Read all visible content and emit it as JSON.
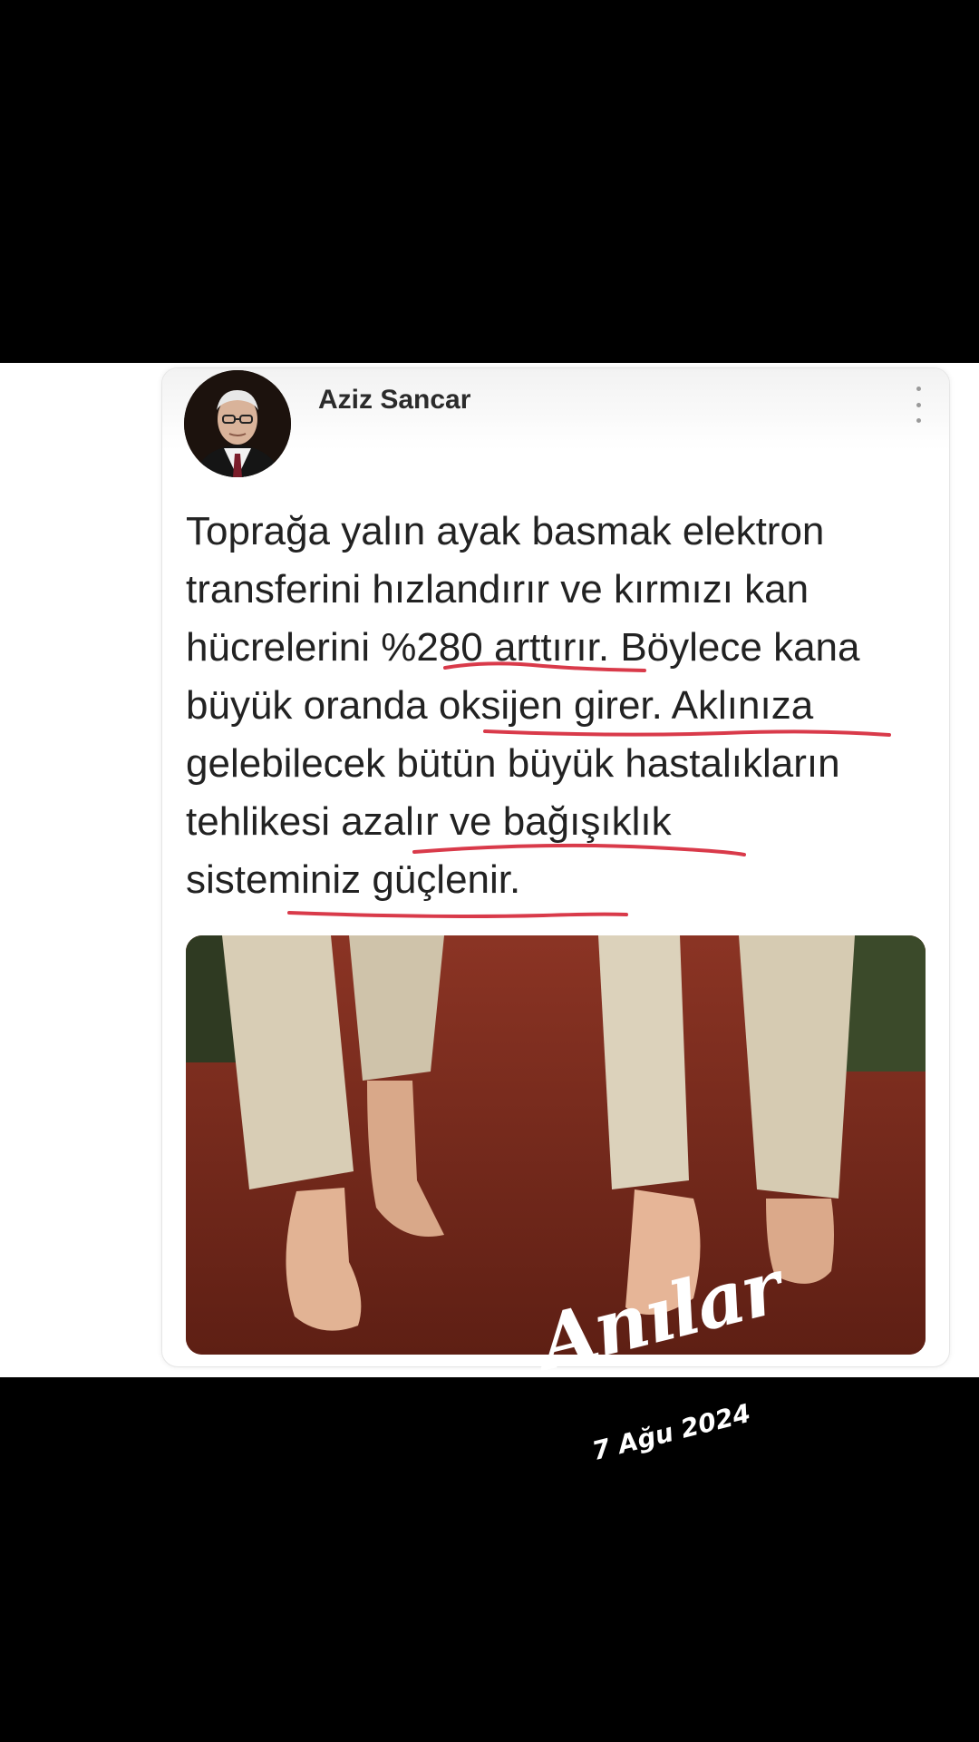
{
  "post": {
    "author": "Aziz Sancar",
    "text": "Toprağa yalın ayak basmak elektron\ntransferini hızlandırır ve kırmızı kan\nhücrelerini %280 arttırır. Böylece kana\nbüyük oranda oksijen girer. Aklınıza\ngelebilecek bütün büyük hastalıkların\ntehlikesi azalır ve bağışıklık\nsisteminiz güçlenir.",
    "underline_color": "#d93a4a",
    "image": "barefoot-walking-on-red-soil-photo"
  },
  "overlay": {
    "title": "Anılar",
    "date": "7 Ağu 2024"
  }
}
